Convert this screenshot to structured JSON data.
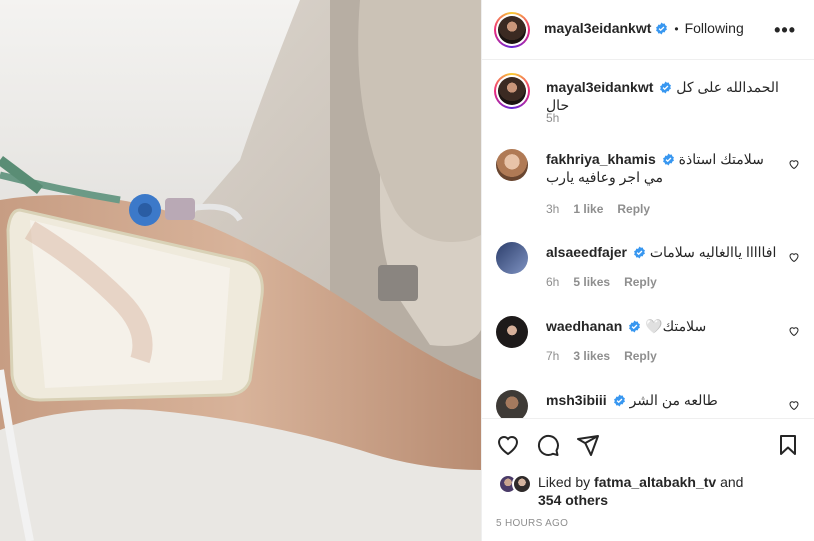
{
  "post": {
    "author": "mayal3eidankwt",
    "separator": "•",
    "follow_label": "Following",
    "more_label": "•••",
    "caption": "الحمدالله على كل حال",
    "caption_age": "5h"
  },
  "comments": [
    {
      "user": "fakhriya_khamis",
      "text": "سلامتك استاذة مي اجر وعافيه يارب",
      "age": "3h",
      "likes": "1 like",
      "reply": "Reply"
    },
    {
      "user": "alsaeedfajer",
      "text": "افااااا ياالغاليه سلامات",
      "age": "6h",
      "likes": "5 likes",
      "reply": "Reply"
    },
    {
      "user": "waedhanan",
      "text": "سلامتك🤍",
      "age": "7h",
      "likes": "3 likes",
      "reply": "Reply"
    },
    {
      "user": "msh3ibiii",
      "text": "طالعه من الشر",
      "age": "",
      "likes": "",
      "reply": ""
    }
  ],
  "footer": {
    "liked_by_prefix": "Liked by",
    "liked_by_user": "fatma_altabakh_tv",
    "liked_by_and": "and",
    "others": "354 others",
    "timestamp": "5 HOURS AGO"
  },
  "colors": {
    "verified": "#3897f0",
    "meta": "#8e8e8e",
    "text": "#262626",
    "border": "#efefef"
  },
  "icons": [
    "heart-icon",
    "comment-icon",
    "share-icon",
    "bookmark-icon",
    "verified-icon",
    "more-icon"
  ]
}
